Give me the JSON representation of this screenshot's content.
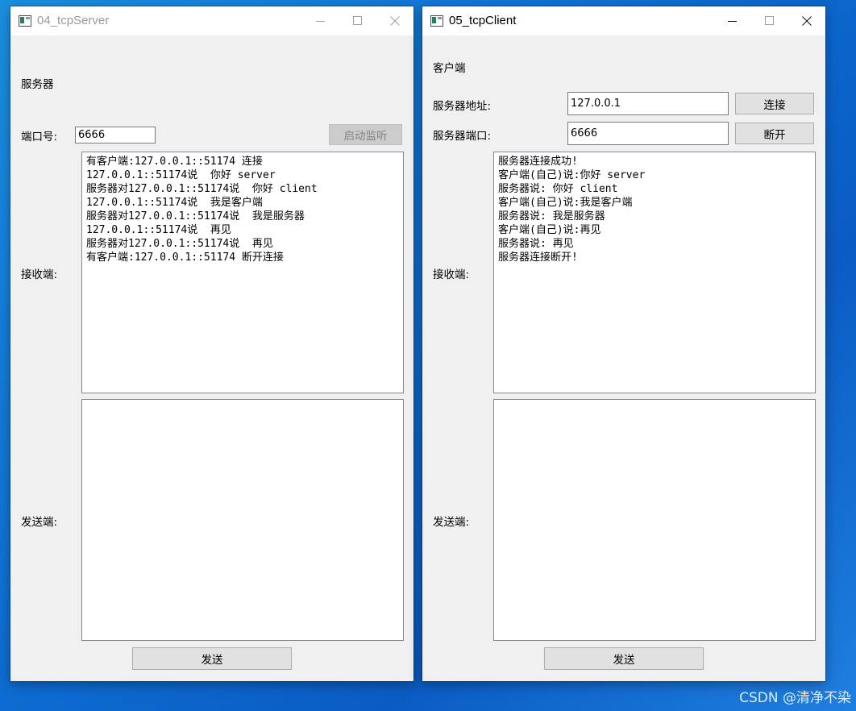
{
  "server": {
    "title": "04_tcpServer",
    "heading": "服务器",
    "port_label": "端口号:",
    "port_value": "6666",
    "listen_button": "启动监听",
    "receive_label": "接收端:",
    "receive_lines": [
      "有客户端:127.0.0.1::51174 连接",
      "127.0.0.1::51174说  你好 server",
      "服务器对127.0.0.1::51174说  你好 client",
      "127.0.0.1::51174说  我是客户端",
      "服务器对127.0.0.1::51174说  我是服务器",
      "127.0.0.1::51174说  再见",
      "服务器对127.0.0.1::51174说  再见",
      "有客户端:127.0.0.1::51174 断开连接"
    ],
    "send_label": "发送端:",
    "send_text": "",
    "send_button": "发送"
  },
  "client": {
    "title": "05_tcpClient",
    "heading": "客户端",
    "address_label": "服务器地址:",
    "address_value": "127.0.0.1",
    "connect_button": "连接",
    "port_label": "服务器端口:",
    "port_value": "6666",
    "disconnect_button": "断开",
    "receive_label": "接收端:",
    "receive_lines": [
      "服务器连接成功!",
      "客户端(自己)说:你好 server",
      "服务器说: 你好 client",
      "客户端(自己)说:我是客户端",
      "服务器说: 我是服务器",
      "客户端(自己)说:再见",
      "服务器说: 再见",
      "服务器连接断开!"
    ],
    "send_label": "发送端:",
    "send_text": "",
    "send_button": "发送"
  },
  "watermark": "CSDN @清净不染",
  "colors": {
    "desktop": "#0e6fd4",
    "window_bg": "#f0f0f0",
    "disabled_button": "#cccccc"
  },
  "icons": {
    "minimize": "minimize-icon",
    "maximize": "maximize-icon",
    "close": "close-icon",
    "app": "app-icon"
  }
}
